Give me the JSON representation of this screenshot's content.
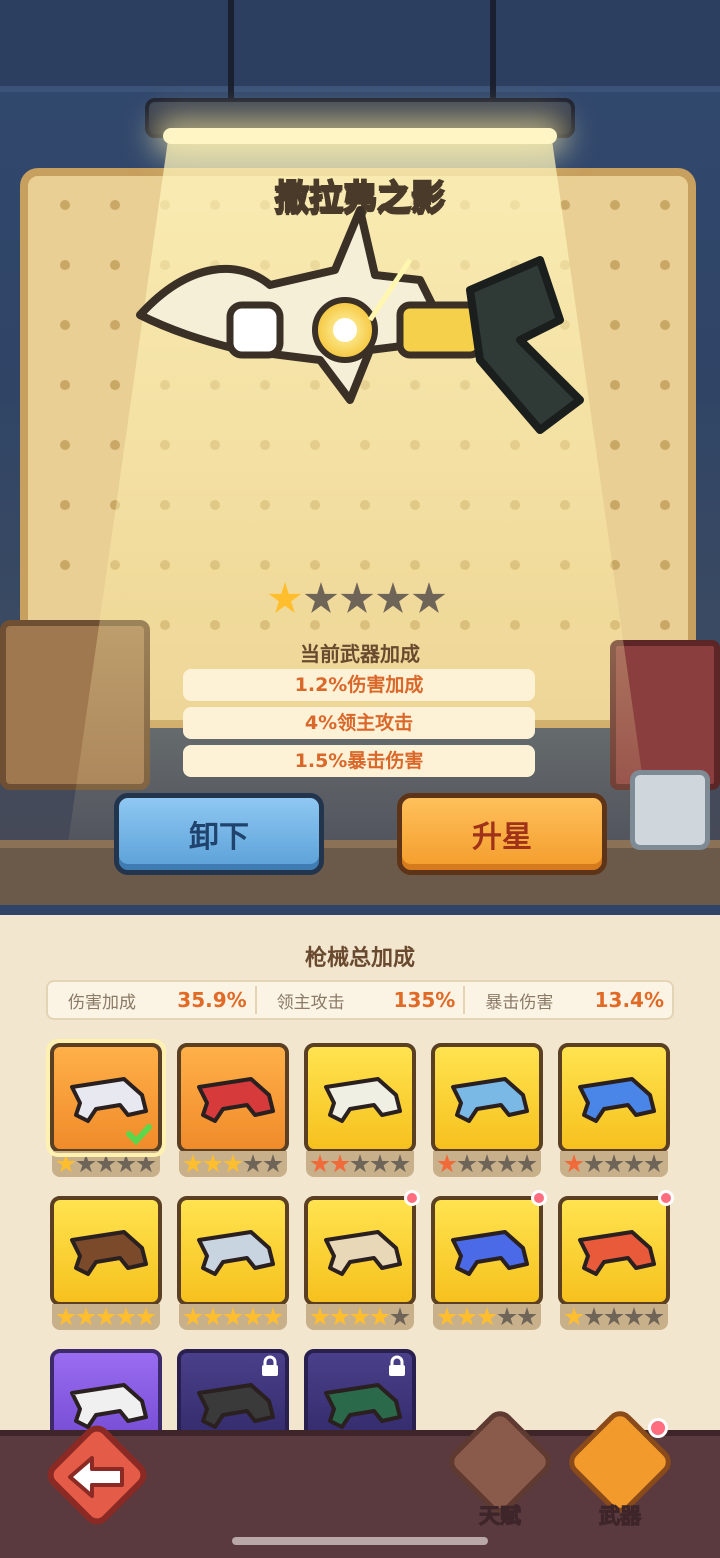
{
  "weapon": {
    "name": "撒拉弗之影",
    "stars": 1,
    "max_stars": 5
  },
  "bonus": {
    "title": "当前武器加成",
    "rows": [
      "1.2%伤害加成",
      "4%领主攻击",
      "1.5%暴击伤害"
    ]
  },
  "actions": {
    "unequip": "卸下",
    "upgrade": "升星"
  },
  "totals": {
    "title": "枪械总加成",
    "stats": [
      {
        "label": "伤害加成",
        "value": "35.9%"
      },
      {
        "label": "领主攻击",
        "value": "135%"
      },
      {
        "label": "暴击伤害",
        "value": "13.4%"
      }
    ]
  },
  "inventory": [
    {
      "icon": "bone-blade-gun-icon",
      "rarity": "orange",
      "stars": 1,
      "star_color": "gold",
      "selected": true,
      "equipped": true
    },
    {
      "icon": "crimson-blade-gun-icon",
      "rarity": "orange",
      "stars": 3,
      "star_color": "gold"
    },
    {
      "icon": "wooden-blaster-icon",
      "rarity": "yellow",
      "stars": 2,
      "star_color": "red"
    },
    {
      "icon": "candy-cannon-icon",
      "rarity": "yellow",
      "stars": 1,
      "star_color": "red"
    },
    {
      "icon": "ice-crystal-gun-icon",
      "rarity": "yellow",
      "stars": 1,
      "star_color": "red"
    },
    {
      "icon": "teddy-bear-blunderbuss-icon",
      "rarity": "yellow",
      "stars": 5,
      "star_color": "gold"
    },
    {
      "icon": "silver-rifle-icon",
      "rarity": "yellow",
      "stars": 5,
      "star_color": "gold"
    },
    {
      "icon": "clockwork-pistol-icon",
      "rarity": "yellow",
      "stars": 4,
      "star_color": "gold",
      "new": true
    },
    {
      "icon": "neon-blaster-icon",
      "rarity": "yellow",
      "stars": 3,
      "star_color": "gold",
      "new": true
    },
    {
      "icon": "toy-pistol-icon",
      "rarity": "yellow",
      "stars": 1,
      "star_color": "gold",
      "new": true
    },
    {
      "icon": "white-sniper-icon",
      "rarity": "purple",
      "locked": false
    },
    {
      "icon": "dark-launcher-icon",
      "rarity": "dark",
      "locked": true
    },
    {
      "icon": "green-cannon-icon",
      "rarity": "dark",
      "locked": true
    }
  ],
  "nav": {
    "talent": "天赋",
    "weapon": "武器"
  },
  "colors": {
    "accent_orange": "#f39d2c",
    "accent_blue": "#5aa0d8",
    "star_gold": "#ffbe2e",
    "star_red": "#f06a3a",
    "stat_value": "#e06a26"
  }
}
